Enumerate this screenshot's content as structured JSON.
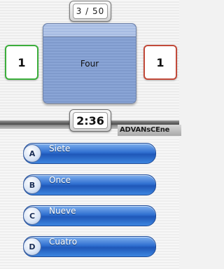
{
  "progress": {
    "text": "3 / 50"
  },
  "card": {
    "word": "Four"
  },
  "scores": {
    "left": "1",
    "right": "1"
  },
  "timer": {
    "text": "2:36"
  },
  "logo": {
    "text": "ADVANsCEne"
  },
  "answers": [
    {
      "letter": "A",
      "text": "Siete"
    },
    {
      "letter": "B",
      "text": "Once"
    },
    {
      "letter": "C",
      "text": "Nueve"
    },
    {
      "letter": "D",
      "text": "Cuatro"
    }
  ],
  "colors": {
    "left_score_border": "#3cae3c",
    "right_score_border": "#c24a3a",
    "answer_button": "#2f6fd0",
    "card": "#8aa5d6"
  }
}
